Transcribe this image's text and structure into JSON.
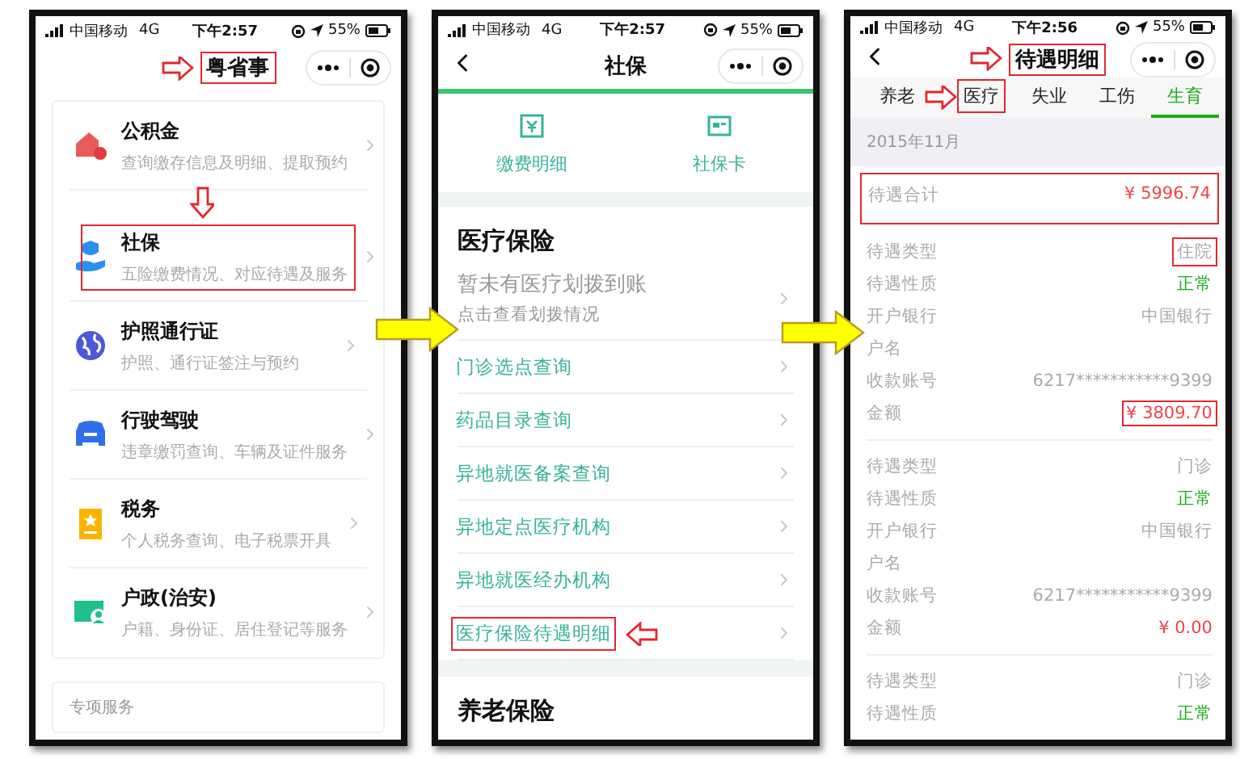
{
  "home": {
    "status": {
      "carrier": "中国移动",
      "network": "4G",
      "time": "下午2:57",
      "battery": "55%"
    },
    "nav": {
      "title": "粤省事",
      "highlight": true,
      "pointer": true
    },
    "items": [
      {
        "title": "公积金",
        "subtitle": "查询缴存信息及明细、提取预约",
        "highlight": false
      },
      {
        "title": "社保",
        "subtitle": "五险缴费情况、对应待遇及服务",
        "highlight": true,
        "pointer": true
      },
      {
        "title": "护照通行证",
        "subtitle": "护照、通行证签注与预约",
        "highlight": false
      },
      {
        "title": "行驶驾驶",
        "subtitle": "违章缴罚查询、车辆及证件服务",
        "highlight": false
      },
      {
        "title": "税务",
        "subtitle": "个人税务查询、电子税票开具",
        "highlight": false
      },
      {
        "title": "户政(治安)",
        "subtitle": "户籍、身份证、居住登记等服务",
        "highlight": false
      }
    ],
    "section": "专项服务"
  },
  "social_security": {
    "status": {
      "carrier": "中国移动",
      "network": "4G",
      "time": "下午2:57",
      "battery": "55%"
    },
    "nav": {
      "title": "社保",
      "highlight": false
    },
    "shortcuts": [
      {
        "label": "缴费明细"
      },
      {
        "label": "社保卡"
      }
    ],
    "section_title": "医疗保险",
    "notice": {
      "title": "暂未有医疗划拨到账",
      "subtitle": "点击查看划拨情况"
    },
    "links": [
      {
        "label": "门诊选点查询",
        "highlight": false
      },
      {
        "label": "药品目录查询",
        "highlight": false
      },
      {
        "label": "异地就医备案查询",
        "highlight": false
      },
      {
        "label": "异地定点医疗机构",
        "highlight": false
      },
      {
        "label": "异地就医经办机构",
        "highlight": false
      },
      {
        "label": "医疗保险待遇明细",
        "highlight": true,
        "pointer": true
      }
    ],
    "next_section": "养老保险"
  },
  "benefit_detail": {
    "status": {
      "carrier": "中国移动",
      "network": "4G",
      "time": "下午2:56",
      "battery": "55%"
    },
    "nav": {
      "title": "待遇明细",
      "highlight": true,
      "pointer": true
    },
    "tabs": [
      {
        "label": "养老",
        "selected": false,
        "highlight": false
      },
      {
        "label": "医疗",
        "selected": false,
        "highlight": true,
        "pointer": true
      },
      {
        "label": "失业",
        "selected": false,
        "highlight": false
      },
      {
        "label": "工伤",
        "selected": false,
        "highlight": false
      },
      {
        "label": "生育",
        "selected": true,
        "highlight": false
      }
    ],
    "month": "2015年11月",
    "total": {
      "label": "待遇合计",
      "value": "¥ 5996.74",
      "highlight": true
    },
    "records": [
      {
        "fields": [
          {
            "label": "待遇类型",
            "value": "住院",
            "kind": "plain",
            "highlight": true
          },
          {
            "label": "待遇性质",
            "value": "正常",
            "kind": "status",
            "highlight": false
          },
          {
            "label": "开户银行",
            "value": "中国银行",
            "kind": "plain",
            "highlight": false
          },
          {
            "label": "户名",
            "kind": "empty",
            "highlight": false
          },
          {
            "label": "收款账号",
            "value": "6217***********9399",
            "kind": "plain",
            "highlight": false
          },
          {
            "label": "金额",
            "value": "¥ 3809.70",
            "kind": "amount",
            "highlight": true
          }
        ]
      },
      {
        "fields": [
          {
            "label": "待遇类型",
            "value": "门诊",
            "kind": "plain",
            "highlight": false
          },
          {
            "label": "待遇性质",
            "value": "正常",
            "kind": "status",
            "highlight": false
          },
          {
            "label": "开户银行",
            "value": "中国银行",
            "kind": "plain",
            "highlight": false
          },
          {
            "label": "户名",
            "kind": "empty",
            "highlight": false
          },
          {
            "label": "收款账号",
            "value": "6217***********9399",
            "kind": "plain",
            "highlight": false
          },
          {
            "label": "金额",
            "value": "¥ 0.00",
            "kind": "amount",
            "highlight": false
          }
        ]
      },
      {
        "fields": [
          {
            "label": "待遇类型",
            "value": "门诊",
            "kind": "plain",
            "highlight": false
          },
          {
            "label": "待遇性质",
            "value": "正常",
            "kind": "status",
            "highlight": false
          }
        ]
      }
    ]
  }
}
